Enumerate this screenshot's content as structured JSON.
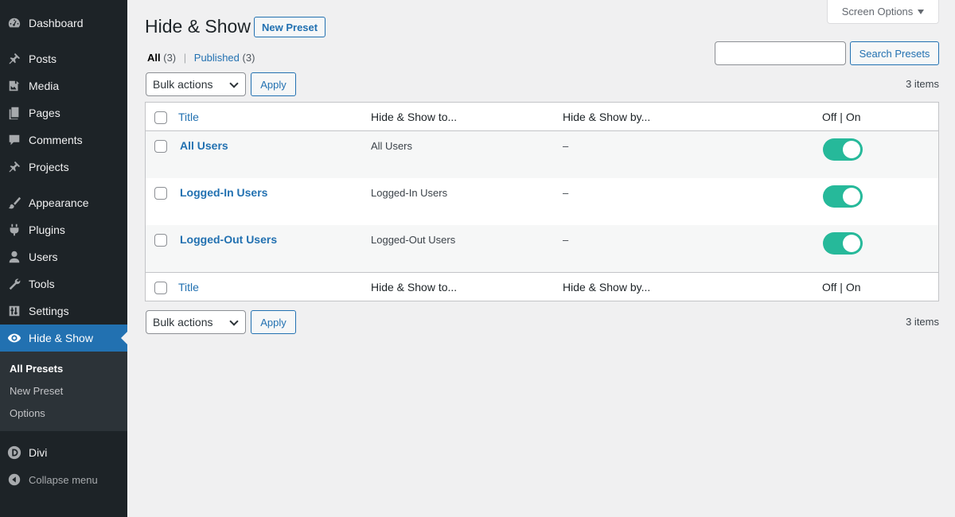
{
  "sidebar": {
    "items": [
      {
        "label": "Dashboard",
        "icon": "dashboard-icon"
      },
      {
        "label": "Posts",
        "icon": "pin-icon"
      },
      {
        "label": "Media",
        "icon": "media-icon"
      },
      {
        "label": "Pages",
        "icon": "pages-icon"
      },
      {
        "label": "Comments",
        "icon": "comment-icon"
      },
      {
        "label": "Projects",
        "icon": "pin-icon"
      },
      {
        "label": "Appearance",
        "icon": "brush-icon"
      },
      {
        "label": "Plugins",
        "icon": "plugin-icon"
      },
      {
        "label": "Users",
        "icon": "user-icon"
      },
      {
        "label": "Tools",
        "icon": "wrench-icon"
      },
      {
        "label": "Settings",
        "icon": "settings-icon"
      },
      {
        "label": "Hide & Show",
        "icon": "eye-icon"
      },
      {
        "label": "Divi",
        "icon": "divi-icon"
      },
      {
        "label": "Collapse menu",
        "icon": "collapse-icon"
      }
    ],
    "submenu": [
      "All Presets",
      "New Preset",
      "Options"
    ]
  },
  "header": {
    "screen_options": "Screen Options",
    "title": "Hide & Show",
    "new_button": "New Preset"
  },
  "filters": {
    "all_label": "All",
    "all_count": "(3)",
    "separator": "|",
    "published_label": "Published",
    "published_count": "(3)"
  },
  "search": {
    "value": "",
    "button": "Search Presets"
  },
  "bulk": {
    "select_label": "Bulk actions",
    "apply_label": "Apply",
    "items_count": "3 items"
  },
  "table": {
    "columns": [
      "Title",
      "Hide & Show to...",
      "Hide & Show by...",
      "Off | On"
    ],
    "rows": [
      {
        "title": "All Users",
        "to": "All Users",
        "by": "–",
        "enabled": true
      },
      {
        "title": "Logged-In Users",
        "to": "Logged-In Users",
        "by": "–",
        "enabled": true
      },
      {
        "title": "Logged-Out Users",
        "to": "Logged-Out Users",
        "by": "–",
        "enabled": true
      }
    ]
  },
  "colors": {
    "sidebar_bg": "#1d2327",
    "accent": "#2271b1",
    "toggle_on": "#26b99a"
  }
}
